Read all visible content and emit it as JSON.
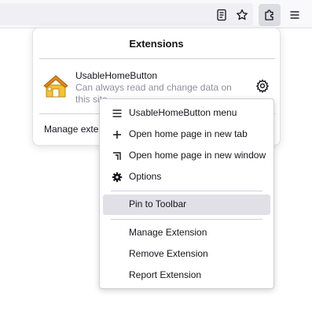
{
  "toolbar": {
    "buttons": [
      {
        "icon": "reader-view-icon"
      },
      {
        "icon": "bookmark-star-icon"
      },
      {
        "icon": "extensions-puzzle-icon",
        "active": true
      },
      {
        "icon": "hamburger-menu-icon"
      }
    ]
  },
  "panel": {
    "title": "Extensions",
    "extension": {
      "name": "UsableHomeButton",
      "description": "Can always read and change data on this site",
      "icon": "house-icon"
    },
    "manage_label": "Manage extensions"
  },
  "context_menu": {
    "items": [
      {
        "label": "UsableHomeButton menu",
        "icon": "menu-lines-icon"
      },
      {
        "label": "Open home page in new tab",
        "icon": "plus-icon"
      },
      {
        "label": "Open home page in new window",
        "icon": "new-window-icon"
      },
      {
        "label": "Options",
        "icon": "gear-icon"
      },
      {
        "label": "Pin to Toolbar",
        "highlighted": true
      },
      {
        "label": "Manage Extension"
      },
      {
        "label": "Remove Extension"
      },
      {
        "label": "Report Extension"
      }
    ]
  },
  "colors": {
    "highlight": "#e0e0e6",
    "muted_text": "#8f8f9d",
    "text": "#15141a"
  }
}
